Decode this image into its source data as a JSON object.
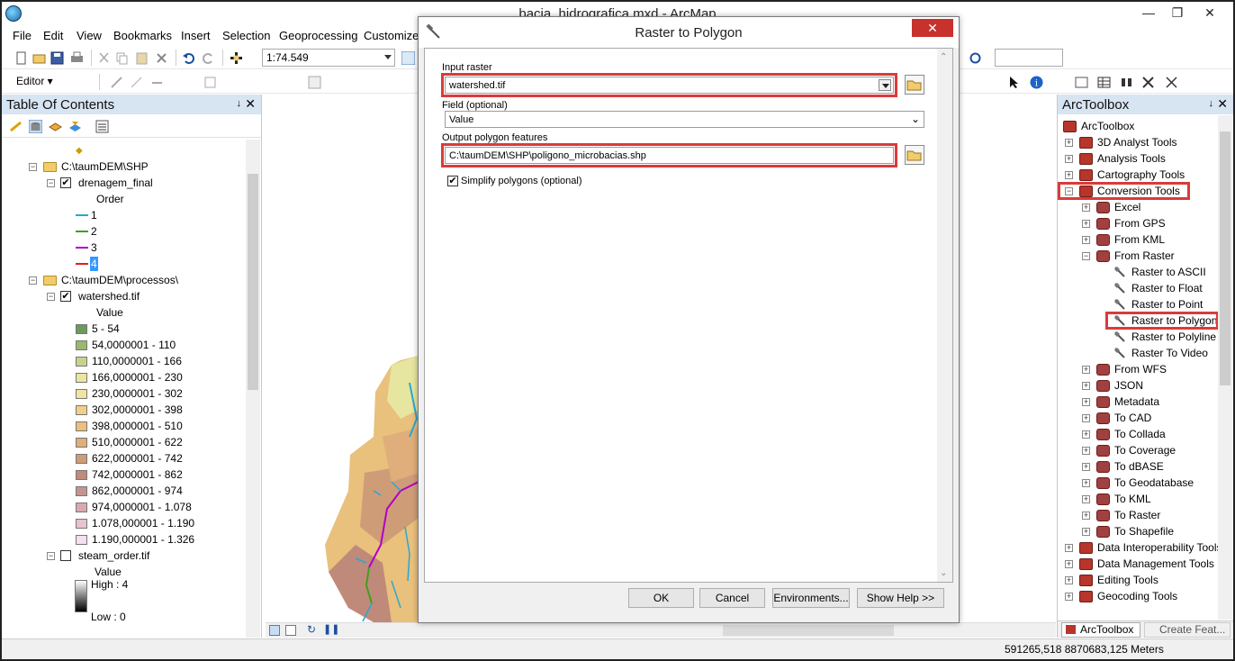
{
  "window": {
    "title": "bacia_hidrografica.mxd - ArcMap",
    "minimize": "—",
    "restore": "❐",
    "close": "✕"
  },
  "menu": [
    "File",
    "Edit",
    "View",
    "Bookmarks",
    "Insert",
    "Selection",
    "Geoprocessing",
    "Customize"
  ],
  "toolbar": {
    "scale": "1:74.549",
    "editor_label": "Editor ▾"
  },
  "toc": {
    "title": "Table Of Contents",
    "groups": [
      {
        "path": "C:\\taumDEM\\SHP",
        "layers": [
          {
            "name": "drenagem_final",
            "checked": true,
            "field": "Order",
            "classes": [
              {
                "label": "1",
                "color": "#2aa6d6"
              },
              {
                "label": "2",
                "color": "#3f9f1d"
              },
              {
                "label": "3",
                "color": "#b000c8"
              },
              {
                "label": "4",
                "color": "#e02020"
              }
            ]
          }
        ]
      },
      {
        "path": "C:\\taumDEM\\processos\\",
        "layers": [
          {
            "name": "watershed.tif",
            "checked": true,
            "field": "Value",
            "classes": [
              {
                "label": "5 - 54",
                "color": "#6e9a5a"
              },
              {
                "label": "54,0000001 - 110",
                "color": "#98b86d"
              },
              {
                "label": "110,0000001 - 166",
                "color": "#c5d48a"
              },
              {
                "label": "166,0000001 - 230",
                "color": "#e8e6a0"
              },
              {
                "label": "230,0000001 - 302",
                "color": "#f1e3a2"
              },
              {
                "label": "302,0000001 - 398",
                "color": "#efd08a"
              },
              {
                "label": "398,0000001 - 510",
                "color": "#e9c07c"
              },
              {
                "label": "510,0000001 - 622",
                "color": "#dfae7a"
              },
              {
                "label": "622,0000001 - 742",
                "color": "#cf9c78"
              },
              {
                "label": "742,0000001 - 862",
                "color": "#c08a7a"
              },
              {
                "label": "862,0000001 - 974",
                "color": "#c59490"
              },
              {
                "label": "974,0000001 - 1.078",
                "color": "#d8aab0"
              },
              {
                "label": "1.078,000001 - 1.190",
                "color": "#e6c3cf"
              },
              {
                "label": "1.190,000001 - 1.326",
                "color": "#f4e0ee"
              }
            ]
          }
        ]
      }
    ],
    "steam": {
      "name": "steam_order.tif",
      "checked": false,
      "field": "Value",
      "high": "High : 4",
      "low": "Low : 0"
    }
  },
  "dialog": {
    "title": "Raster to Polygon",
    "close": "✕",
    "input_raster_label": "Input raster",
    "input_raster_value": "watershed.tif",
    "field_label": "Field (optional)",
    "field_value": "Value",
    "output_label": "Output polygon features",
    "output_value": "C:\\taumDEM\\SHP\\poligono_microbacias.shp",
    "simplify_label": "Simplify polygons (optional)",
    "simplify_checked": "✔",
    "buttons": {
      "ok": "OK",
      "cancel": "Cancel",
      "env": "Environments...",
      "help": "Show Help >>"
    }
  },
  "toolbox": {
    "title": "ArcToolbox",
    "root": "ArcToolbox",
    "items_top": [
      "3D Analyst Tools",
      "Analysis Tools",
      "Cartography Tools",
      "Conversion Tools"
    ],
    "conversion_children": [
      "Excel",
      "From GPS",
      "From KML",
      "From Raster"
    ],
    "raster_tools": [
      "Raster to ASCII",
      "Raster to Float",
      "Raster to Point",
      "Raster to Polygon",
      "Raster to Polyline",
      "Raster To Video"
    ],
    "conversion_more": [
      "From WFS",
      "JSON",
      "Metadata",
      "To CAD",
      "To Collada",
      "To Coverage",
      "To dBASE",
      "To Geodatabase",
      "To KML",
      "To Raster",
      "To Shapefile"
    ],
    "items_bottom": [
      "Data Interoperability Tools",
      "Data Management Tools",
      "Editing Tools",
      "Geocoding Tools"
    ],
    "tabs": {
      "arctoolbox": "ArcToolbox",
      "create": "Create Feat..."
    }
  },
  "status": {
    "coords": "591265,518  8870683,125 Meters"
  }
}
